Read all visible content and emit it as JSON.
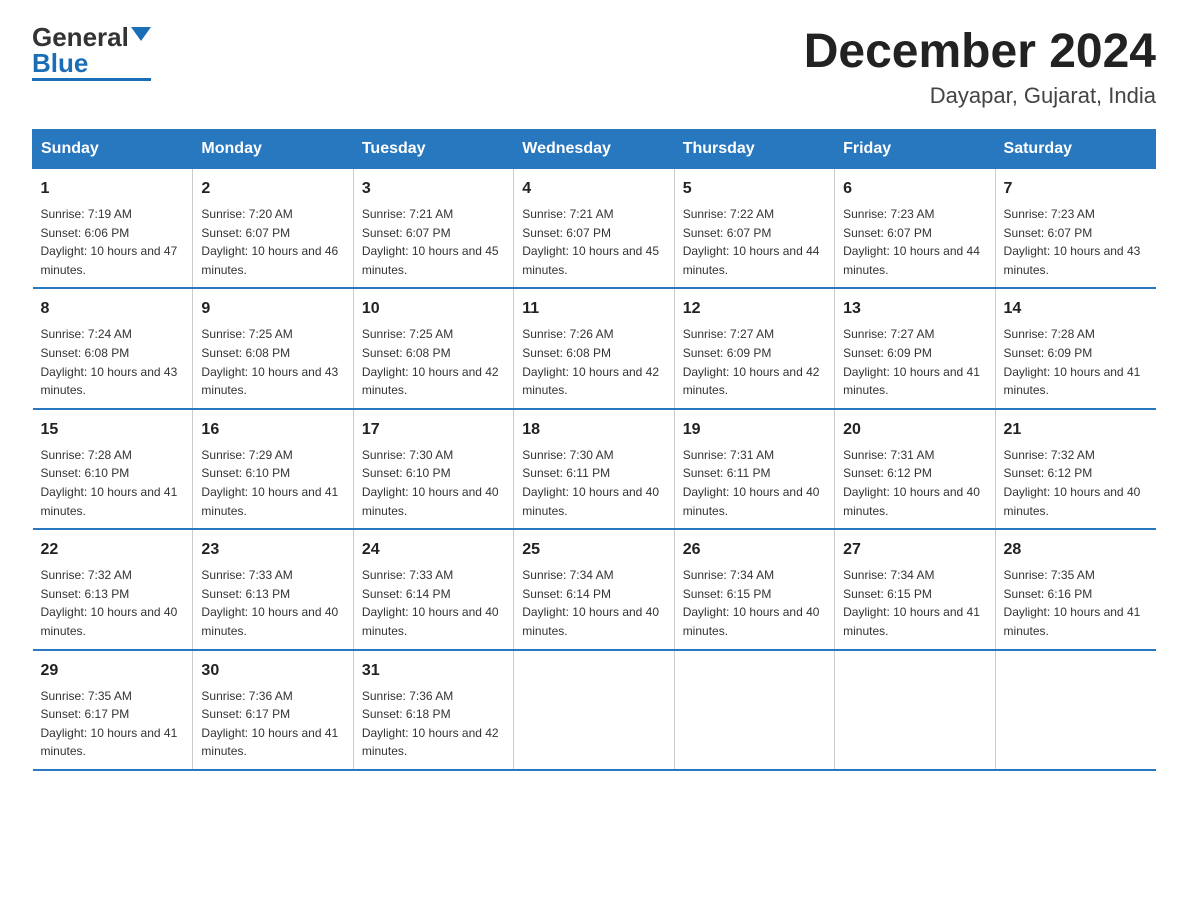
{
  "header": {
    "logo_general": "General",
    "logo_blue": "Blue",
    "month_title": "December 2024",
    "location": "Dayapar, Gujarat, India"
  },
  "weekdays": [
    "Sunday",
    "Monday",
    "Tuesday",
    "Wednesday",
    "Thursday",
    "Friday",
    "Saturday"
  ],
  "weeks": [
    [
      {
        "day": "1",
        "sunrise": "7:19 AM",
        "sunset": "6:06 PM",
        "daylight": "10 hours and 47 minutes."
      },
      {
        "day": "2",
        "sunrise": "7:20 AM",
        "sunset": "6:07 PM",
        "daylight": "10 hours and 46 minutes."
      },
      {
        "day": "3",
        "sunrise": "7:21 AM",
        "sunset": "6:07 PM",
        "daylight": "10 hours and 45 minutes."
      },
      {
        "day": "4",
        "sunrise": "7:21 AM",
        "sunset": "6:07 PM",
        "daylight": "10 hours and 45 minutes."
      },
      {
        "day": "5",
        "sunrise": "7:22 AM",
        "sunset": "6:07 PM",
        "daylight": "10 hours and 44 minutes."
      },
      {
        "day": "6",
        "sunrise": "7:23 AM",
        "sunset": "6:07 PM",
        "daylight": "10 hours and 44 minutes."
      },
      {
        "day": "7",
        "sunrise": "7:23 AM",
        "sunset": "6:07 PM",
        "daylight": "10 hours and 43 minutes."
      }
    ],
    [
      {
        "day": "8",
        "sunrise": "7:24 AM",
        "sunset": "6:08 PM",
        "daylight": "10 hours and 43 minutes."
      },
      {
        "day": "9",
        "sunrise": "7:25 AM",
        "sunset": "6:08 PM",
        "daylight": "10 hours and 43 minutes."
      },
      {
        "day": "10",
        "sunrise": "7:25 AM",
        "sunset": "6:08 PM",
        "daylight": "10 hours and 42 minutes."
      },
      {
        "day": "11",
        "sunrise": "7:26 AM",
        "sunset": "6:08 PM",
        "daylight": "10 hours and 42 minutes."
      },
      {
        "day": "12",
        "sunrise": "7:27 AM",
        "sunset": "6:09 PM",
        "daylight": "10 hours and 42 minutes."
      },
      {
        "day": "13",
        "sunrise": "7:27 AM",
        "sunset": "6:09 PM",
        "daylight": "10 hours and 41 minutes."
      },
      {
        "day": "14",
        "sunrise": "7:28 AM",
        "sunset": "6:09 PM",
        "daylight": "10 hours and 41 minutes."
      }
    ],
    [
      {
        "day": "15",
        "sunrise": "7:28 AM",
        "sunset": "6:10 PM",
        "daylight": "10 hours and 41 minutes."
      },
      {
        "day": "16",
        "sunrise": "7:29 AM",
        "sunset": "6:10 PM",
        "daylight": "10 hours and 41 minutes."
      },
      {
        "day": "17",
        "sunrise": "7:30 AM",
        "sunset": "6:10 PM",
        "daylight": "10 hours and 40 minutes."
      },
      {
        "day": "18",
        "sunrise": "7:30 AM",
        "sunset": "6:11 PM",
        "daylight": "10 hours and 40 minutes."
      },
      {
        "day": "19",
        "sunrise": "7:31 AM",
        "sunset": "6:11 PM",
        "daylight": "10 hours and 40 minutes."
      },
      {
        "day": "20",
        "sunrise": "7:31 AM",
        "sunset": "6:12 PM",
        "daylight": "10 hours and 40 minutes."
      },
      {
        "day": "21",
        "sunrise": "7:32 AM",
        "sunset": "6:12 PM",
        "daylight": "10 hours and 40 minutes."
      }
    ],
    [
      {
        "day": "22",
        "sunrise": "7:32 AM",
        "sunset": "6:13 PM",
        "daylight": "10 hours and 40 minutes."
      },
      {
        "day": "23",
        "sunrise": "7:33 AM",
        "sunset": "6:13 PM",
        "daylight": "10 hours and 40 minutes."
      },
      {
        "day": "24",
        "sunrise": "7:33 AM",
        "sunset": "6:14 PM",
        "daylight": "10 hours and 40 minutes."
      },
      {
        "day": "25",
        "sunrise": "7:34 AM",
        "sunset": "6:14 PM",
        "daylight": "10 hours and 40 minutes."
      },
      {
        "day": "26",
        "sunrise": "7:34 AM",
        "sunset": "6:15 PM",
        "daylight": "10 hours and 40 minutes."
      },
      {
        "day": "27",
        "sunrise": "7:34 AM",
        "sunset": "6:15 PM",
        "daylight": "10 hours and 41 minutes."
      },
      {
        "day": "28",
        "sunrise": "7:35 AM",
        "sunset": "6:16 PM",
        "daylight": "10 hours and 41 minutes."
      }
    ],
    [
      {
        "day": "29",
        "sunrise": "7:35 AM",
        "sunset": "6:17 PM",
        "daylight": "10 hours and 41 minutes."
      },
      {
        "day": "30",
        "sunrise": "7:36 AM",
        "sunset": "6:17 PM",
        "daylight": "10 hours and 41 minutes."
      },
      {
        "day": "31",
        "sunrise": "7:36 AM",
        "sunset": "6:18 PM",
        "daylight": "10 hours and 42 minutes."
      },
      {
        "day": "",
        "sunrise": "",
        "sunset": "",
        "daylight": ""
      },
      {
        "day": "",
        "sunrise": "",
        "sunset": "",
        "daylight": ""
      },
      {
        "day": "",
        "sunrise": "",
        "sunset": "",
        "daylight": ""
      },
      {
        "day": "",
        "sunrise": "",
        "sunset": "",
        "daylight": ""
      }
    ]
  ]
}
